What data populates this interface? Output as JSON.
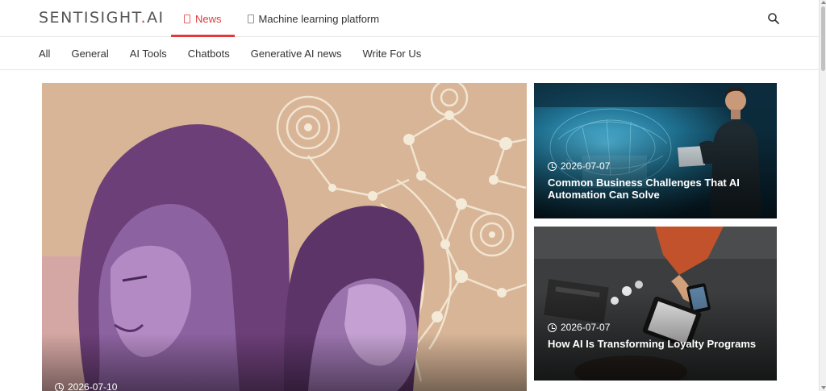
{
  "header": {
    "logo_text": "SENTISIGHT",
    "logo_dot": ".",
    "logo_suffix": "AI",
    "tabs": [
      {
        "label": "News",
        "active": true
      },
      {
        "label": "Machine learning platform",
        "active": false
      }
    ],
    "search_icon": "search-icon"
  },
  "categories": [
    "All",
    "General",
    "AI Tools",
    "Chatbots",
    "Generative AI news",
    "Write For Us"
  ],
  "hero": {
    "date": "2026-07-10",
    "image": "illustration-woman-man-profiles-tech-network"
  },
  "cards": [
    {
      "date": "2026-07-07",
      "title": "Common Business Challenges That AI Automation Can Solve",
      "image": "businessman-digital-brain"
    },
    {
      "date": "2026-07-07",
      "title": "How AI Is Transforming Loyalty Programs",
      "image": "desk-with-phone-and-tablet"
    }
  ],
  "colors": {
    "accent": "#e23a3a",
    "text": "#333333",
    "border": "#e5e5e5"
  }
}
